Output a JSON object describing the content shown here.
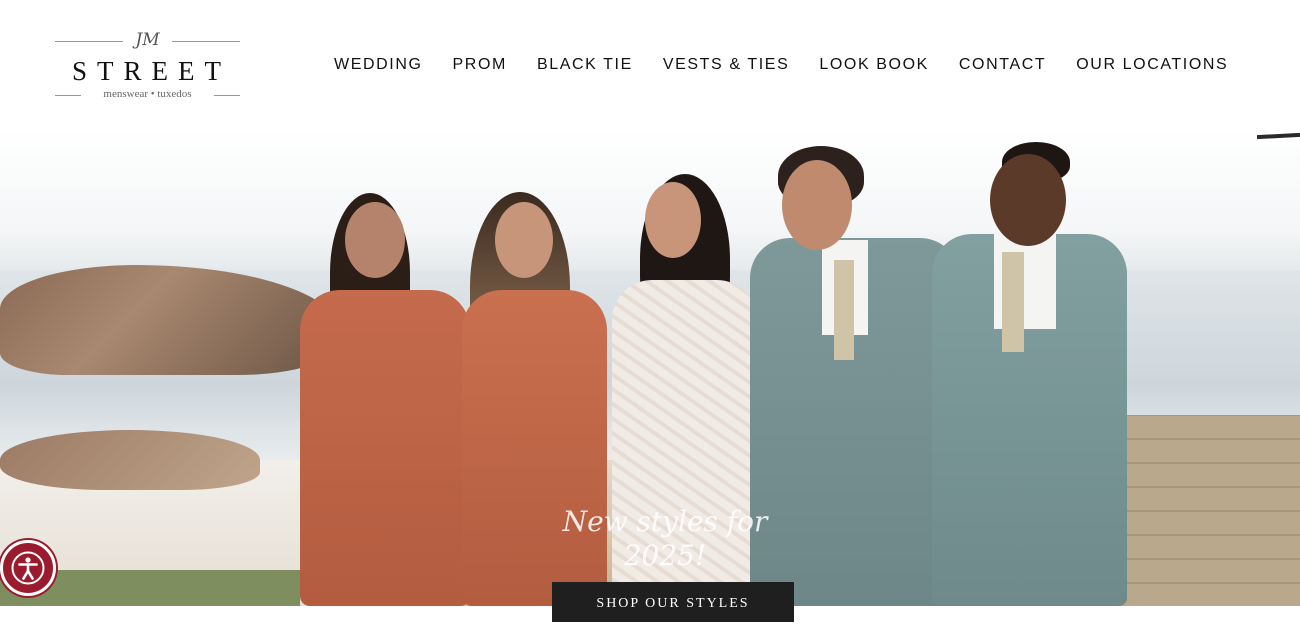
{
  "logo": {
    "monogram": "JM",
    "wordmark": "STREET",
    "tagline": "menswear • tuxedos"
  },
  "nav": {
    "items": [
      {
        "label": "WEDDING"
      },
      {
        "label": "PROM"
      },
      {
        "label": "BLACK TIE"
      },
      {
        "label": "VESTS & TIES"
      },
      {
        "label": "LOOK BOOK"
      },
      {
        "label": "CONTACT"
      },
      {
        "label": "OUR LOCATIONS"
      }
    ]
  },
  "hero": {
    "headline": "New styles for 2025!",
    "cta_label": "SHOP OUR STYLES"
  },
  "accessibility": {
    "icon": "accessibility-icon",
    "color": "#9b1b2e"
  }
}
